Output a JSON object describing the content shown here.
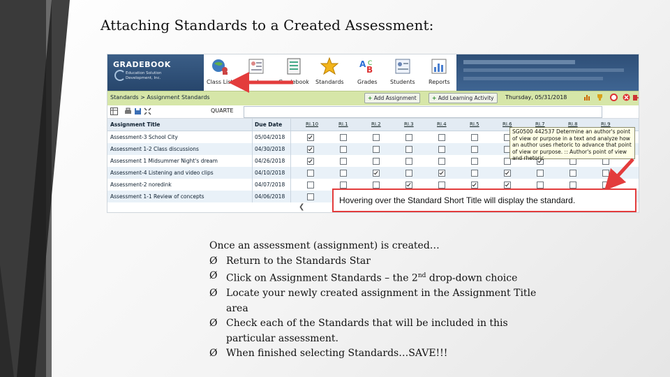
{
  "slide": {
    "title": "Attaching Standards to a Created Assessment:",
    "callout": "Hovering over the Standard Short Title will display the standard.",
    "intro": "Once an assessment (assignment) is created…",
    "bullet_glyph": "Ø",
    "steps": [
      "Return to the Standards Star",
      "Click on Assignment Standards – the 2",
      "Locate your newly created assignment in the Assignment Title area",
      "Check each of the Standards that will be included in this particular assessment.",
      "When finished selecting Standards…SAVE!!!"
    ],
    "step2_sup": "nd",
    "step2_rest": " drop-down choice"
  },
  "app": {
    "logo_title": "GRADEBOOK",
    "logo_sub": "Education Solution Development, Inc.",
    "nav": [
      {
        "label": "Class List",
        "icon": "globe-people-icon"
      },
      {
        "label": "Attendance",
        "icon": "attendance-icon"
      },
      {
        "label": "Gradebook",
        "icon": "gradebook-icon"
      },
      {
        "label": "Standards",
        "icon": "star-icon"
      },
      {
        "label": "Grades",
        "icon": "grades-icon"
      },
      {
        "label": "Students",
        "icon": "students-icon"
      },
      {
        "label": "Reports",
        "icon": "reports-icon"
      }
    ],
    "breadcrumb": "Standards > Assignment Standards",
    "add_assignment": "Add Assignment",
    "add_activity": "Add Learning Activity",
    "date": "Thursday, 05/31/2018",
    "quarter": "QUARTE",
    "columns": {
      "title": "Assignment Title",
      "date": "Due Date",
      "standards": [
        "RI.10",
        "RI.1",
        "RI.2",
        "RI.3",
        "RI.4",
        "RI.5",
        "RI.6",
        "RI.7",
        "RI.8",
        "RI.9"
      ]
    },
    "rows": [
      {
        "title": "Assessment-3 School City",
        "date": "05/04/2018",
        "checks": [
          1,
          0,
          0,
          0,
          0,
          0,
          0,
          0,
          0,
          0
        ]
      },
      {
        "title": "Assessment 1-2 Class discussions",
        "date": "04/30/2018",
        "checks": [
          1,
          0,
          0,
          0,
          0,
          0,
          0,
          0,
          0,
          0
        ]
      },
      {
        "title": "Assessment 1 Midsummer Night's dream",
        "date": "04/26/2018",
        "checks": [
          1,
          0,
          0,
          0,
          0,
          0,
          0,
          1,
          0,
          0
        ]
      },
      {
        "title": "Assessment-4 Listening and video clips",
        "date": "04/10/2018",
        "checks": [
          0,
          0,
          1,
          0,
          1,
          0,
          1,
          0,
          0,
          0
        ]
      },
      {
        "title": "Assessment-2 noredink",
        "date": "04/07/2018",
        "checks": [
          0,
          0,
          0,
          1,
          0,
          1,
          1,
          0,
          0,
          0
        ]
      },
      {
        "title": "Assessment 1-1 Review of concepts",
        "date": "04/06/2018",
        "checks": [
          0,
          0,
          0,
          0,
          0,
          0,
          0,
          0,
          0,
          0
        ]
      }
    ],
    "tooltip": "SG0500 442537 Determine an author's point of view or purpose in a text and analyze how an author uses rhetoric to advance that point of view or purpose. :: Author's point of view and rhetoric"
  },
  "colors": {
    "arrow": "#e33c3c",
    "crumb_bg": "#d6e6a8",
    "logo_bg": "#2f4f77"
  }
}
